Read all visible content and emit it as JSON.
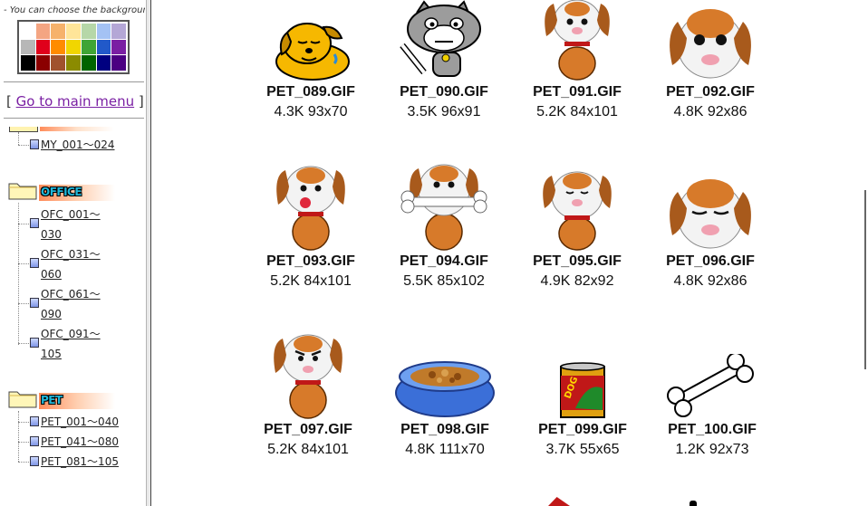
{
  "sidebar": {
    "background_caption": "- You can choose the background",
    "palette": [
      "#ffffff",
      "#f4a582",
      "#f6b26b",
      "#ffe599",
      "#b6d7a8",
      "#a4c2f4",
      "#b4a7d6",
      "#b7b7b7",
      "#e0001b",
      "#ff8c00",
      "#f1d600",
      "#3fa535",
      "#2159c9",
      "#7a1fa3",
      "#000000",
      "#8b0000",
      "#a0522d",
      "#8b8b00",
      "#006400",
      "#000080",
      "#4b0082"
    ],
    "main_menu": {
      "open": "[ ",
      "link": "Go to main menu",
      "close": " ]"
    },
    "top_item": "MY_001～024",
    "categories": [
      {
        "banner": "OFFICE",
        "items": [
          "OFC_001～030",
          "OFC_031～060",
          "OFC_061～090",
          "OFC_091～105"
        ]
      },
      {
        "banner": "PET",
        "items": [
          "PET_001～040",
          "PET_041～080",
          "PET_081～105"
        ]
      }
    ]
  },
  "gallery": [
    {
      "name": "PET_089.GIF",
      "info": "4.3K 93x70",
      "icon": "yellow-dog-sleeping-icon"
    },
    {
      "name": "PET_090.GIF",
      "info": "3.5K 96x91",
      "icon": "gray-cat-with-bone-icon"
    },
    {
      "name": "PET_091.GIF",
      "info": "5.2K 84x101",
      "icon": "puppy-sitting-icon"
    },
    {
      "name": "PET_092.GIF",
      "info": "4.8K 92x86",
      "icon": "puppy-face-icon"
    },
    {
      "name": "PET_093.GIF",
      "info": "5.2K 84x101",
      "icon": "puppy-tongue-icon"
    },
    {
      "name": "PET_094.GIF",
      "info": "5.5K 85x102",
      "icon": "puppy-with-bone-icon"
    },
    {
      "name": "PET_095.GIF",
      "info": "4.9K 82x92",
      "icon": "puppy-sad-icon"
    },
    {
      "name": "PET_096.GIF",
      "info": "4.8K 92x86",
      "icon": "puppy-face-sleepy-icon"
    },
    {
      "name": "PET_097.GIF",
      "info": "5.2K 84x101",
      "icon": "puppy-angry-icon"
    },
    {
      "name": "PET_098.GIF",
      "info": "4.8K 111x70",
      "icon": "food-bowl-icon"
    },
    {
      "name": "PET_099.GIF",
      "info": "3.7K 55x65",
      "icon": "dog-food-can-icon"
    },
    {
      "name": "PET_100.GIF",
      "info": "1.2K 92x73",
      "icon": "bone-icon"
    }
  ],
  "can_label": "DOG"
}
